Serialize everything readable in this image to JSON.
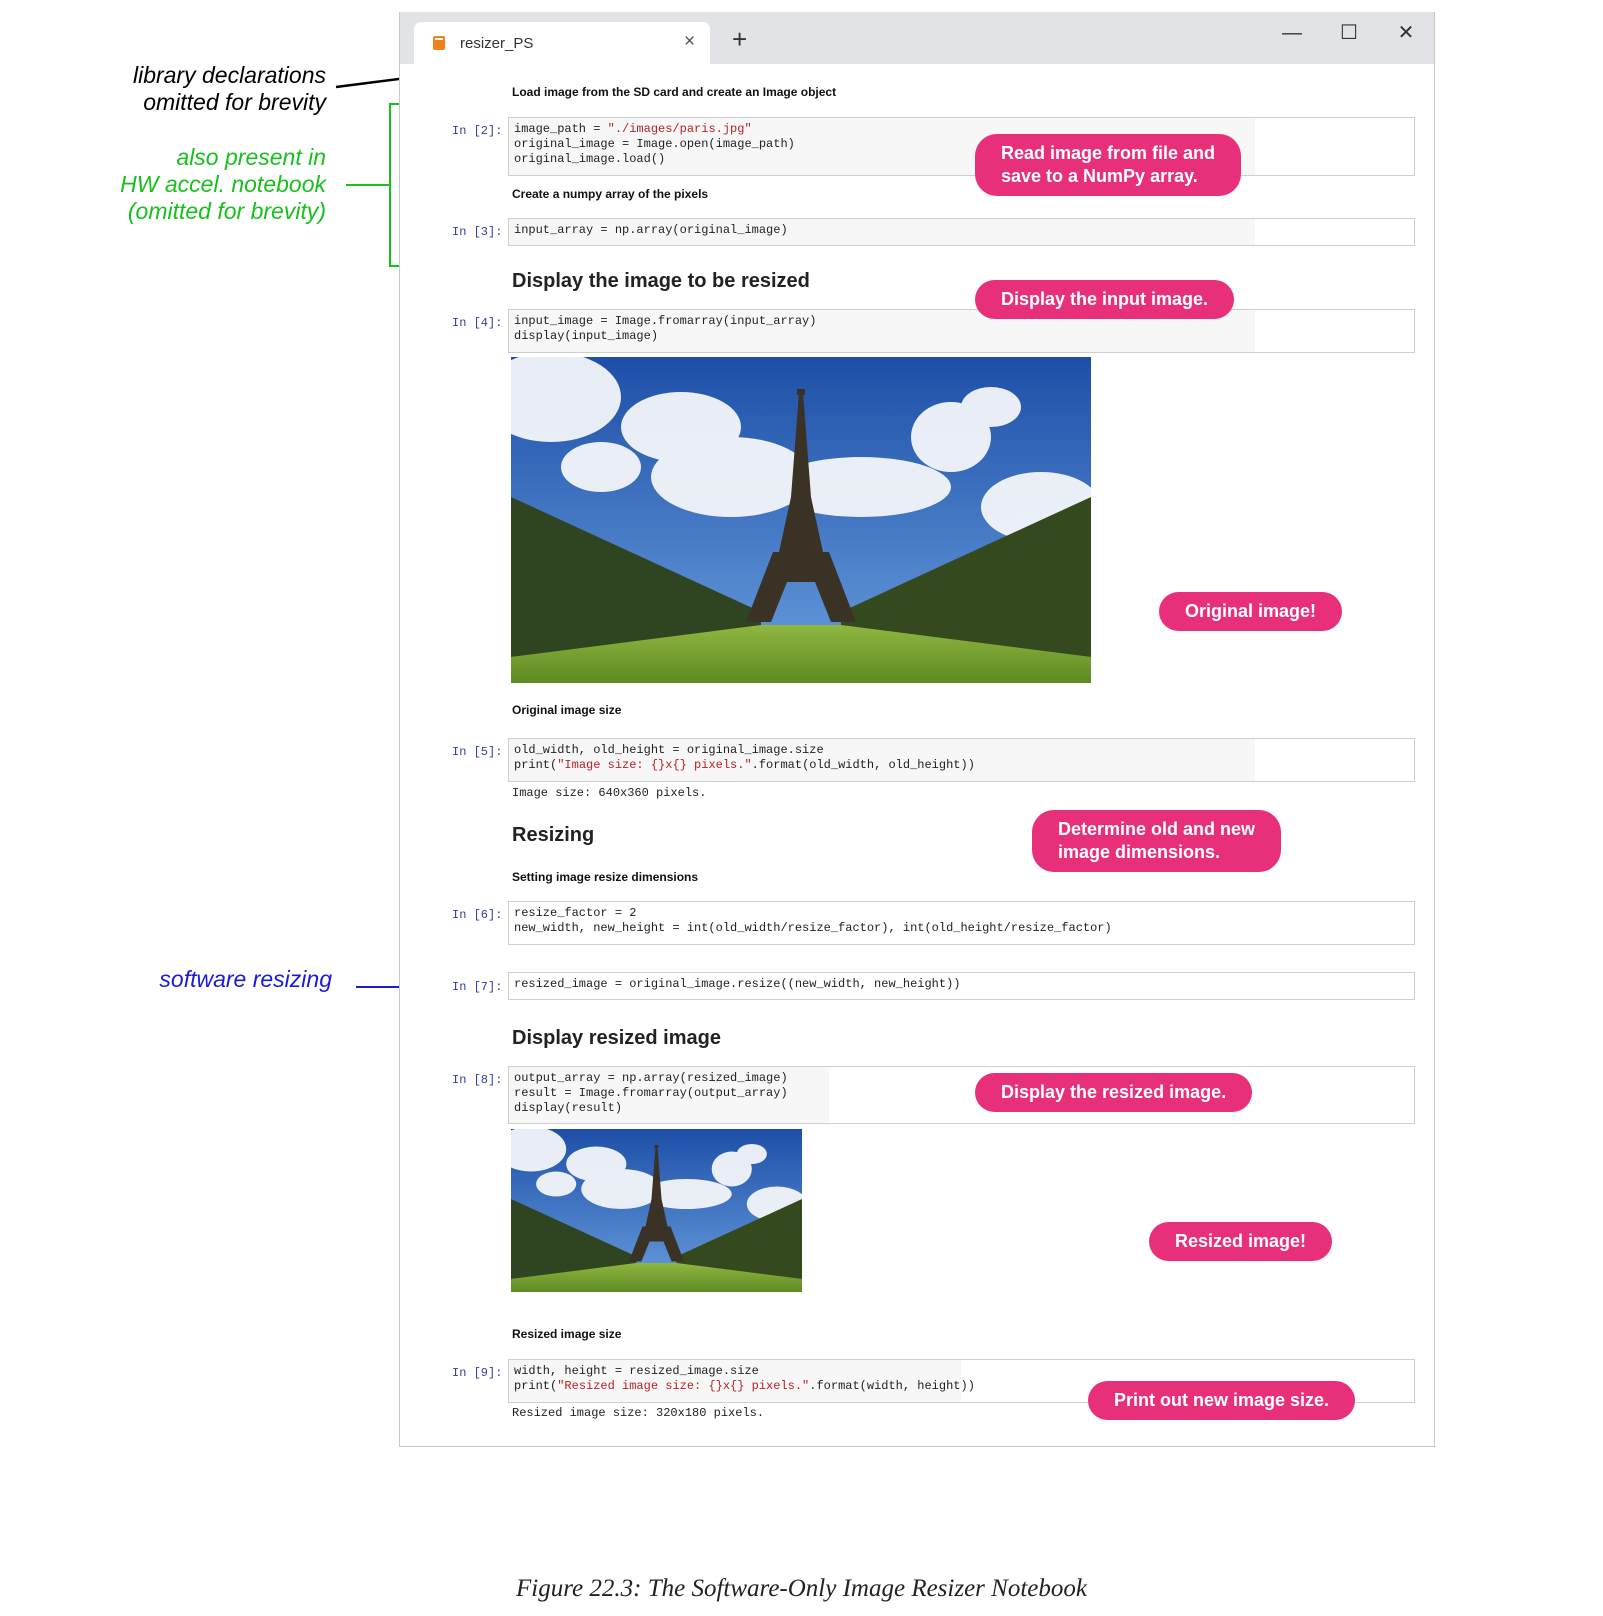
{
  "window": {
    "tab_title": "resizer_PS",
    "tab_close": "×",
    "new_tab": "+",
    "minimize": "—",
    "maximize": "☐",
    "close": "✕"
  },
  "notebook": {
    "md_load": "Load image from the SD card and create an Image object",
    "md_numpy": "Create a numpy array of the pixels",
    "h_display": "Display the image to be resized",
    "md_orig_size": "Original image size",
    "h_resizing": "Resizing",
    "md_setting": "Setting image resize dimensions",
    "h_display_resized": "Display resized image",
    "md_resized_size": "Resized image size",
    "cells": {
      "c2": {
        "prompt": "In [2]:",
        "l1a": "image_path = ",
        "l1b": "\"./images/paris.jpg\"",
        "l2": "original_image = Image.open(image_path)",
        "l3": "original_image.load()"
      },
      "c3": {
        "prompt": "In [3]:",
        "l1": "input_array = np.array(original_image)"
      },
      "c4": {
        "prompt": "In [4]:",
        "l1": "input_image = Image.fromarray(input_array)",
        "l2": "display(input_image)"
      },
      "c5": {
        "prompt": "In [5]:",
        "l1": "old_width, old_height = original_image.size",
        "l2a": "print(",
        "l2b": "\"Image size: {}x{} pixels.\"",
        "l2c": ".format(old_width, old_height))",
        "output": "Image size: 640x360 pixels."
      },
      "c6": {
        "prompt": "In [6]:",
        "l1": "resize_factor = 2",
        "l2": "new_width, new_height = int(old_width/resize_factor), int(old_height/resize_factor)"
      },
      "c7": {
        "prompt": "In [7]:",
        "l1": "resized_image = original_image.resize((new_width, new_height))"
      },
      "c8": {
        "prompt": "In [8]:",
        "l1": "output_array = np.array(resized_image)",
        "l2": "result = Image.fromarray(output_array)",
        "l3": "display(result)"
      },
      "c9": {
        "prompt": "In [9]:",
        "l1": "width, height = resized_image.size",
        "l2a": "print(",
        "l2b": "\"Resized image size: {}x{} pixels.\"",
        "l2c": ".format(width, height))",
        "output": "Resized image size: 320x180 pixels."
      }
    }
  },
  "annotations": {
    "library": "library declarations omitted for brevity",
    "library_l1": "library declarations",
    "library_l2": "omitted for brevity",
    "hw_l1": "also present in",
    "hw_l2": "HW accel. notebook",
    "hw_l3": "(omitted for brevity)",
    "software": "software resizing",
    "call_read_l1": "Read image from file and",
    "call_read_l2": "save to a NumPy array.",
    "call_display_input": "Display the input image.",
    "call_original": "Original image!",
    "call_dims_l1": "Determine old and new",
    "call_dims_l2": "image dimensions.",
    "call_display_resized": "Display the resized image.",
    "call_resized": "Resized image!",
    "call_print": "Print out new image size.",
    "caption": "Figure 22.3:  The Software-Only Image Resizer Notebook"
  },
  "colors": {
    "callout": "#e8307a",
    "green_note": "#18c01e",
    "blue_note": "#1a1adc",
    "prompt": "#303f9f"
  }
}
